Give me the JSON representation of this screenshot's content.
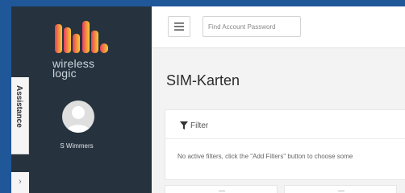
{
  "sidebar": {
    "logo_text_line1": "wireless",
    "logo_text_line2": "logic",
    "username": "S Wimmers",
    "assistance_tab": "Assistance",
    "collapse_chevron": "›"
  },
  "header": {
    "menu_icon": "hamburger-icon",
    "search_placeholder": "Find Account Password"
  },
  "main": {
    "page_title": "SIM-Karten",
    "filter": {
      "label": "Filter",
      "icon": "funnel-icon",
      "empty_message": "No active filters, click the \"Add Filters\" button to choose some"
    }
  },
  "colors": {
    "background": "#1f5799",
    "sidebar": "#26333f",
    "logo_gradient": [
      "#e83a6b",
      "#f08a3c",
      "#f7c93a"
    ]
  }
}
